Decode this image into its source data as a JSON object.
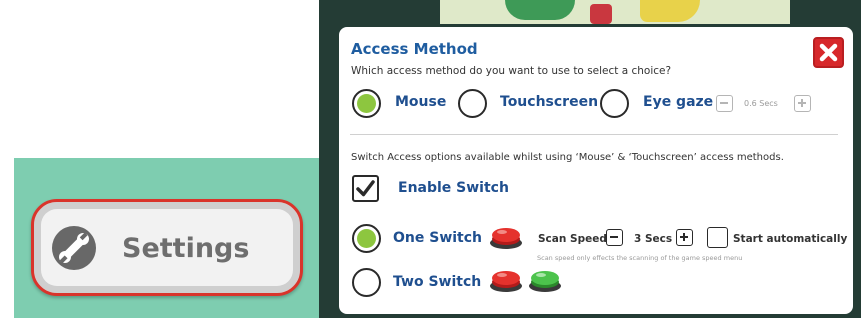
{
  "settings_button": {
    "label": "Settings",
    "icon": "wrench-icon"
  },
  "dialog": {
    "title": "Access Method",
    "subtitle": "Which access method do you want to use to select a choice?",
    "close_icon": "close-icon",
    "access_methods": [
      {
        "label": "Mouse",
        "selected": true
      },
      {
        "label": "Touchscreen",
        "selected": false
      },
      {
        "label": "Eye gaze",
        "selected": false
      }
    ],
    "eye_gaze_time": "0.6 Secs",
    "switch_info": "Switch Access options available whilst using ‘Mouse’ & ‘Touchscreen’ access methods.",
    "enable_switch": {
      "label": "Enable Switch",
      "checked": true
    },
    "switch_modes": [
      {
        "label": "One Switch",
        "selected": true
      },
      {
        "label": "Two Switch",
        "selected": false
      }
    ],
    "scan_speed_label": "Scan Speed:",
    "scan_speed_value": "3 Secs",
    "start_auto_label": "Start automatically",
    "scan_note": "Scan speed only effects the scanning of the game speed menu",
    "colors": {
      "accent_green": "#8dc63f",
      "title_blue": "#1f5da0",
      "close_red": "#d7282b",
      "border_red": "#d9342b",
      "teal": "#7ecdb0"
    }
  }
}
